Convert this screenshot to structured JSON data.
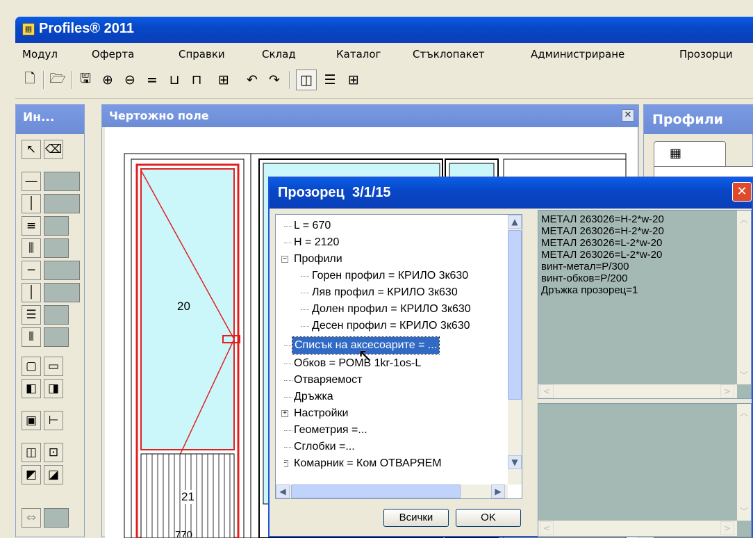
{
  "app": {
    "title": "Profiles® 2011",
    "icon": "app-grid-icon"
  },
  "menu": [
    "Модул",
    "Оферта",
    "Справки",
    "Склад",
    "Каталог",
    "Стъклопакет",
    "Администриране",
    "Прозорци"
  ],
  "toolbar": {
    "buttons": [
      "new-file-icon",
      "open-folder-icon",
      "save-icon",
      "zoom-in-icon",
      "zoom-out-icon",
      "equal-icon",
      "profile-bottom-icon",
      "profile-top-icon",
      "grid-frame-icon",
      "undo-icon",
      "redo-icon",
      "split-view-icon",
      "list-view-icon",
      "table-view-icon"
    ]
  },
  "tools_panel": {
    "title": "Ин..."
  },
  "drawing_panel": {
    "title": "Чертожно поле",
    "labels": {
      "sash": "20",
      "mosquito": "21",
      "bottom_dim": "770"
    }
  },
  "profiles_panel": {
    "title": "Профили"
  },
  "dialog": {
    "title": "Прозорец  3/1/15",
    "tree": [
      {
        "text": "L = 670",
        "level": 0
      },
      {
        "text": "H = 2120",
        "level": 0
      },
      {
        "text": "Профили",
        "level": 0,
        "expander": "−"
      },
      {
        "text": "Горен профил =  КРИЛО 3к630",
        "level": 1
      },
      {
        "text": "Ляв профил =  КРИЛО 3к630",
        "level": 1
      },
      {
        "text": "Долен профил =  КРИЛО 3к630",
        "level": 1
      },
      {
        "text": "Десен профил =  КРИЛО 3к630",
        "level": 1
      },
      {
        "text": "Списък на аксесоарите = ...",
        "level": 0,
        "selected": true
      },
      {
        "text": "Обков =  РОМВ 1kr-1os-L",
        "level": 0
      },
      {
        "text": "Отваряемост",
        "level": 0
      },
      {
        "text": "Дръжка",
        "level": 0
      },
      {
        "text": "Настройки",
        "level": 0,
        "expander": "+"
      },
      {
        "text": "Геометрия  =...",
        "level": 0
      },
      {
        "text": "Сглобки  =...",
        "level": 0
      },
      {
        "text": "Комарник =  Ком ОТВАРЯЕМ",
        "level": 0,
        "expander": "−"
      }
    ],
    "accessories": [
      "МЕТАЛ 263026=H-2*w-20",
      "МЕТАЛ 263026=H-2*w-20",
      "МЕТАЛ 263026=L-2*w-20",
      "МЕТАЛ 263026=L-2*w-20",
      "винт-метал=P/300",
      "винт-обков=P/200",
      "Дръжка прозорец=1"
    ],
    "buttons": {
      "all": "Всички",
      "ok": "OK"
    }
  },
  "colors": {
    "titlebar": "#0a5ee6",
    "panel_title": "#7a9ae4",
    "glass": "#ccf7fa",
    "frame_red": "#e02020",
    "selected": "#316ac5",
    "list_bg": "#a4b9b4"
  }
}
